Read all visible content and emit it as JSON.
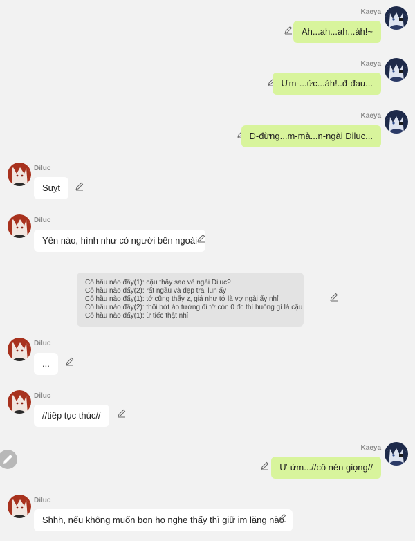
{
  "speakers": {
    "kaeya": "Kaeya",
    "diluc": "Diluc"
  },
  "messages": [
    {
      "speaker": "Kaeya",
      "text": "Ah...ah...ah...áh!~"
    },
    {
      "speaker": "Kaeya",
      "text": "Ưm-...ức...áh!..đ-đau..."
    },
    {
      "speaker": "Kaeya",
      "text": "Đ-đừng...m-mà...n-ngài Diluc..."
    },
    {
      "speaker": "Diluc",
      "text": "Suỵt"
    },
    {
      "speaker": "Diluc",
      "text": "Yên nào, hình như có người bên ngoài"
    },
    {
      "speaker": "Diluc",
      "text": "..."
    },
    {
      "speaker": "Diluc",
      "text": "//tiếp tục thúc//"
    },
    {
      "speaker": "Kaeya",
      "text": "Ư-ứm...//cố nén giọng//"
    },
    {
      "speaker": "Diluc",
      "text": "Shhh, nếu không muốn bọn họ nghe thấy thì giữ im lặng nào"
    }
  ],
  "note": {
    "lines": [
      "Cô hầu nào đấy(1): cậu thấy sao về ngài Diluc?",
      "Cô hầu nào đấy(2): rất ngầu và đẹp trai lun ấy",
      "Cô hầu nào đấy(1): tớ cũng thấy z, giá như tớ là vợ ngài ấy nhỉ",
      "Cô hầu nào đấy(2): thôi bớt ảo tưởng đi tớ còn 0 đc thì huống gì là cậu",
      "Cô hầu nào đấy(1): ừ tiếc thật nhỉ"
    ]
  },
  "colors": {
    "background": "#f2f2f2",
    "bubble_right": "#d8f49c",
    "bubble_left": "#ffffff",
    "note_bg": "#e3e3e3",
    "fab": "#b8b8b8"
  },
  "icons": {
    "edit": "pencil-icon",
    "fab": "pencil-fab-icon",
    "avatar_kaeya": "kaeya-avatar",
    "avatar_diluc": "diluc-avatar"
  }
}
